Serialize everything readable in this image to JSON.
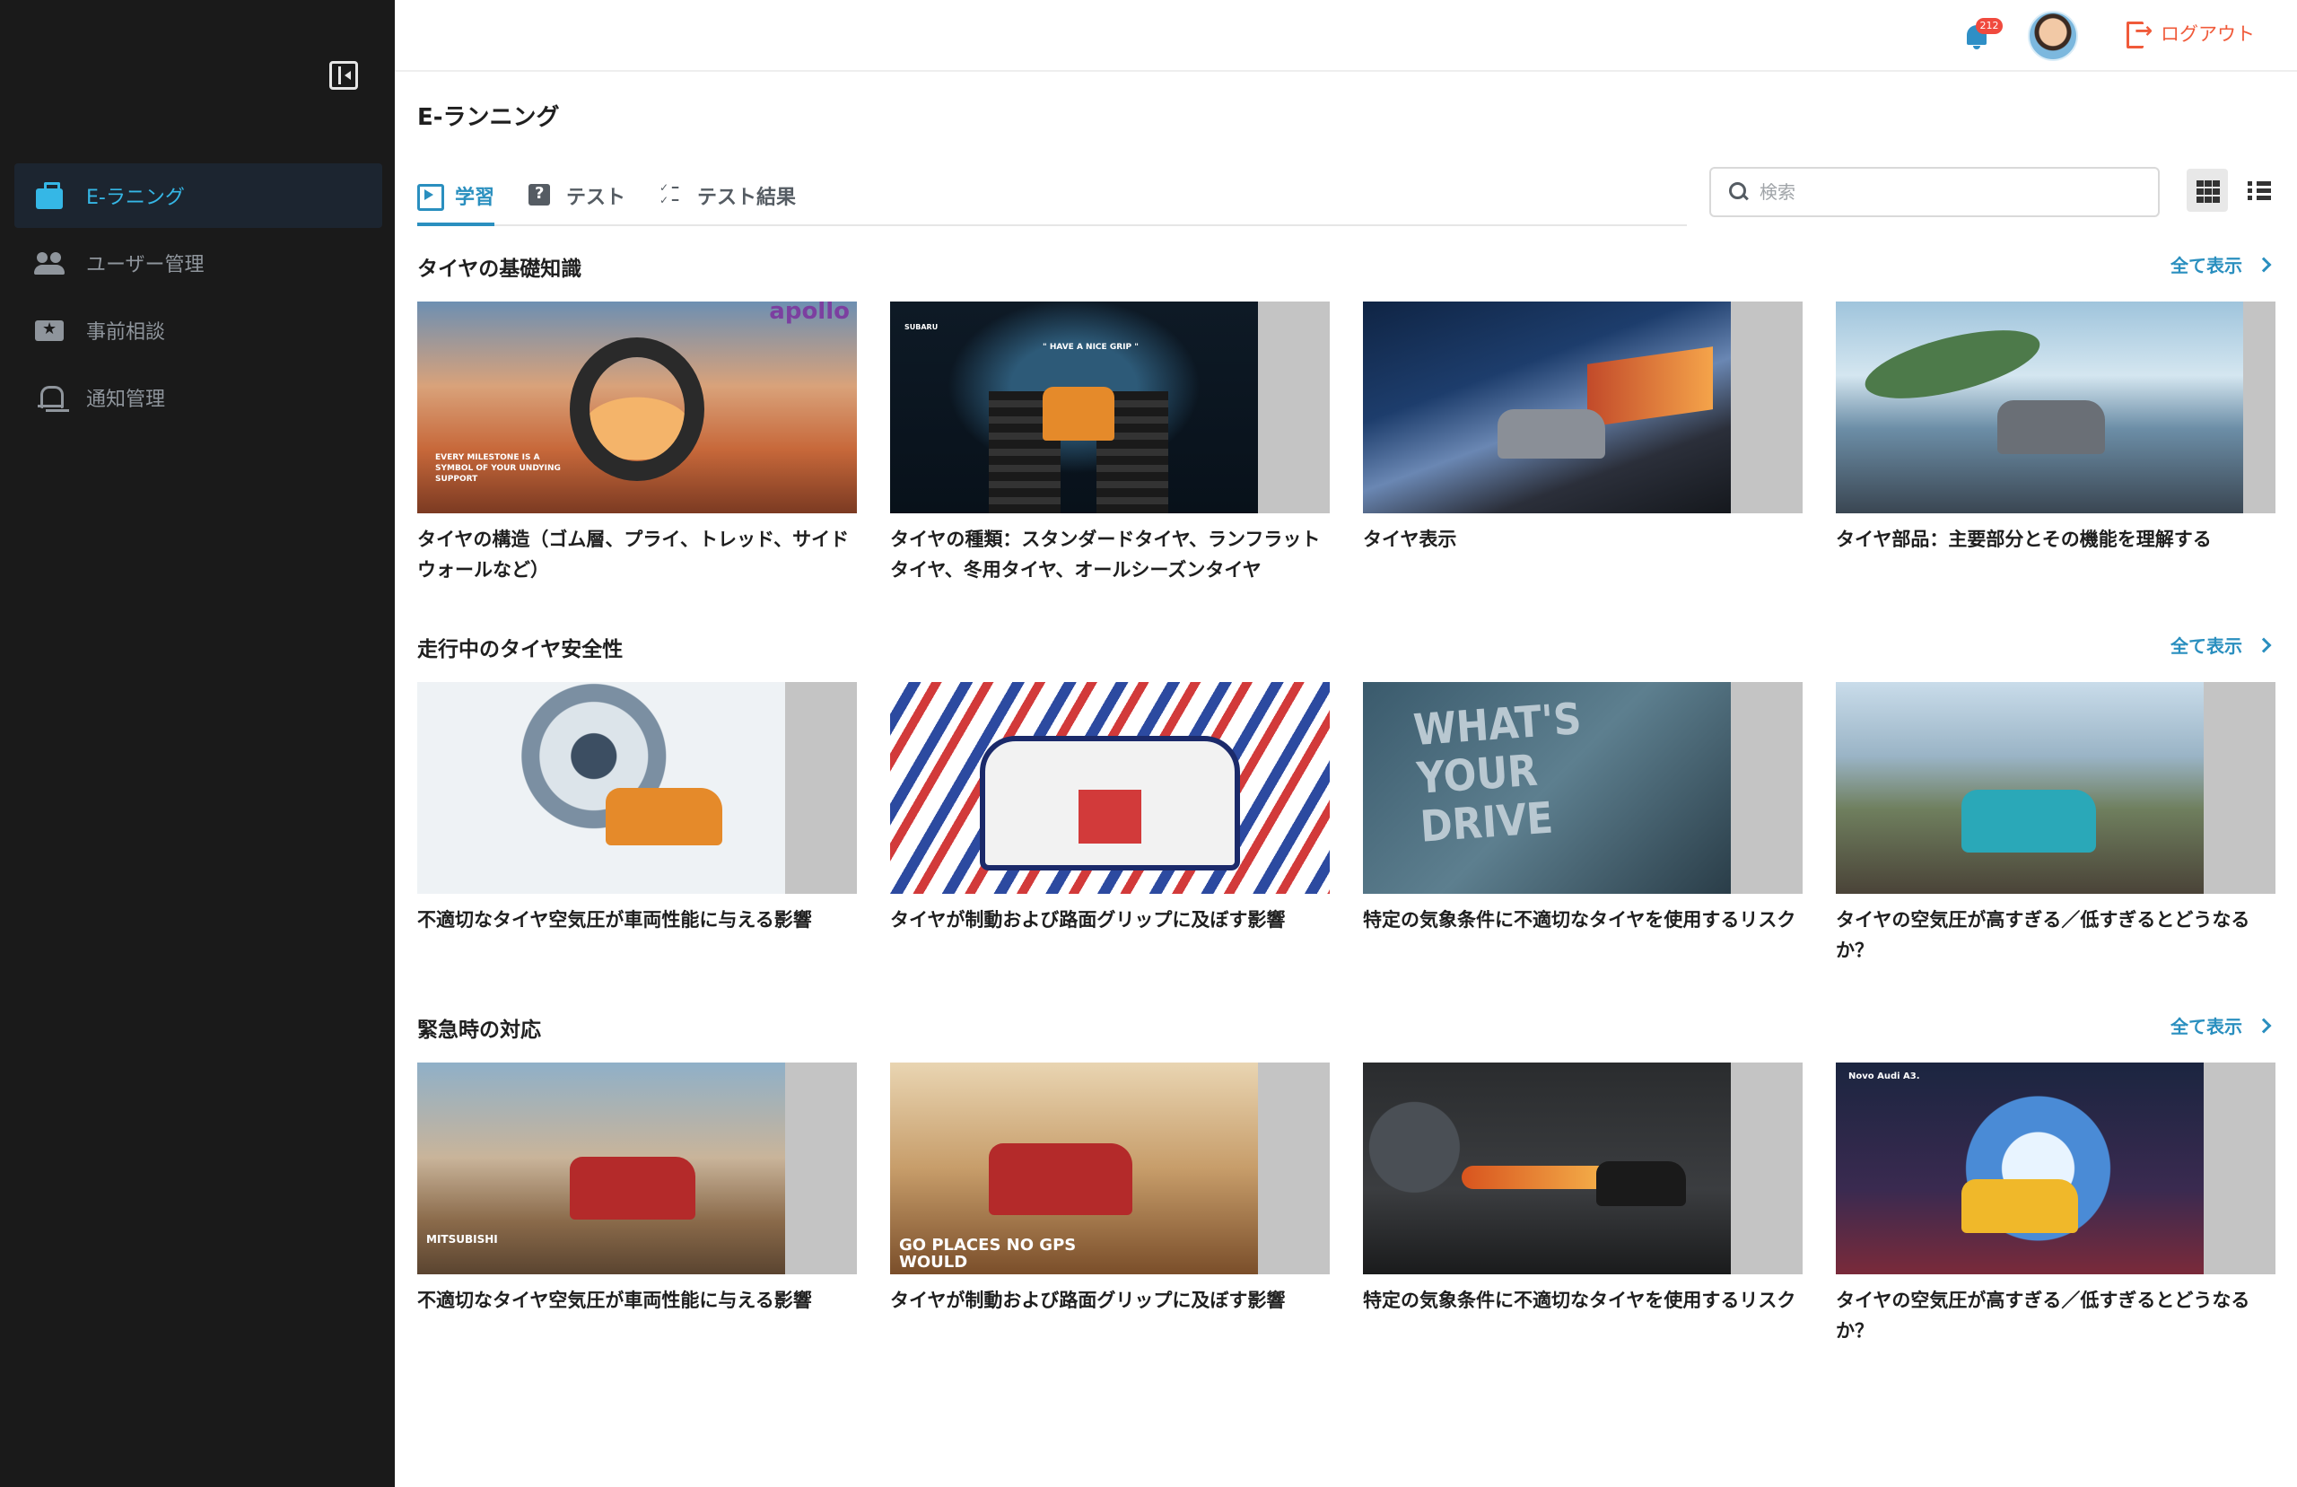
{
  "sidebar": {
    "items": [
      {
        "label": "E-ラニング",
        "icon": "briefcase-icon",
        "active": true
      },
      {
        "label": "ユーザー管理",
        "icon": "users-icon",
        "active": false
      },
      {
        "label": "事前相談",
        "icon": "ticket-star-icon",
        "active": false
      },
      {
        "label": "通知管理",
        "icon": "bell-icon",
        "active": false
      }
    ]
  },
  "header": {
    "notification_count": "212",
    "logout_label": "ログアウト"
  },
  "page": {
    "title": "E-ランニング"
  },
  "tabs": [
    {
      "label": "学習",
      "icon": "play-square-icon",
      "active": true
    },
    {
      "label": "テスト",
      "icon": "quiz-icon",
      "active": false
    },
    {
      "label": "テスト結果",
      "icon": "checklist-icon",
      "active": false
    }
  ],
  "search": {
    "placeholder": "検索",
    "value": ""
  },
  "view_mode": "grid",
  "see_all_label": "全て表示",
  "sections": [
    {
      "title": "タイヤの基礎知識",
      "cards": [
        {
          "title": "タイヤの構造（ゴム層、プライ、トレッド、サイドウォールなど）",
          "overlay_text": "EVERY MILESTONE IS A SYMBOL OF YOUR UNDYING SUPPORT",
          "brand_text": "apollo"
        },
        {
          "title": "タイヤの種類：スタンダードタイヤ、ランフラットタイヤ、冬用タイヤ、オールシーズンタイヤ",
          "overlay_text": "\" HAVE A NICE GRIP \"",
          "brand_text": "SUBARU"
        },
        {
          "title": "タイヤ表示"
        },
        {
          "title": "タイヤ部品：主要部分とその機能を理解する"
        }
      ]
    },
    {
      "title": "走行中のタイヤ安全性",
      "cards": [
        {
          "title": "不適切なタイヤ空気圧が車両性能に与える影響"
        },
        {
          "title": "タイヤが制動および路面グリップに及ぼす影響"
        },
        {
          "title": "特定の気象条件に不適切なタイヤを使用するリスク",
          "overlay_text": "WHAT'S YOUR DRIVE"
        },
        {
          "title": "タイヤの空気圧が高すぎる／低すぎるとどうなるか？"
        }
      ]
    },
    {
      "title": "緊急時の対応",
      "cards": [
        {
          "title": "不適切なタイヤ空気圧が車両性能に与える影響",
          "overlay_text": "MITSUBISHI"
        },
        {
          "title": "タイヤが制動および路面グリップに及ぼす影響",
          "overlay_text": "GO PLACES NO GPS WOULD"
        },
        {
          "title": "特定の気象条件に不適切なタイヤを使用するリスク"
        },
        {
          "title": "タイヤの空気圧が高すぎる／低すぎるとどうなるか？",
          "overlay_text": "Novo Audi A3."
        }
      ]
    }
  ]
}
